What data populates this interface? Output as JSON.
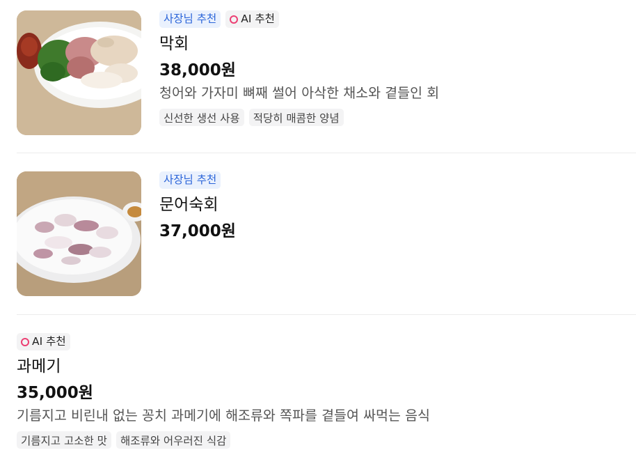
{
  "items": [
    {
      "badges": {
        "owner": "사장님 추천",
        "ai": "AI 추천"
      },
      "name": "막회",
      "price": "38,000원",
      "description": "청어와 가자미 뼈째 썰어 아삭한 채소와 곁들인 회",
      "tags": [
        "신선한 생선 사용",
        "적당히 매콤한 양념"
      ]
    },
    {
      "badges": {
        "owner": "사장님 추천"
      },
      "name": "문어숙회",
      "price": "37,000원"
    },
    {
      "badges": {
        "ai": "AI 추천"
      },
      "name": "과메기",
      "price": "35,000원",
      "description": "기름지고 비린내 없는 꽁치 과메기에 해조류와 쪽파를 곁들여 싸먹는 음식",
      "tags": [
        "기름지고 고소한 맛",
        "해조류와 어우러진 식감"
      ]
    }
  ],
  "colors": {
    "owner_badge_text": "#2a64d9",
    "owner_badge_bg": "#eaf1fd",
    "ai_ring": "#ec3f73",
    "tag_bg": "#f3f3f4"
  },
  "icons": {
    "ai_badge": "pink-ring-icon"
  }
}
